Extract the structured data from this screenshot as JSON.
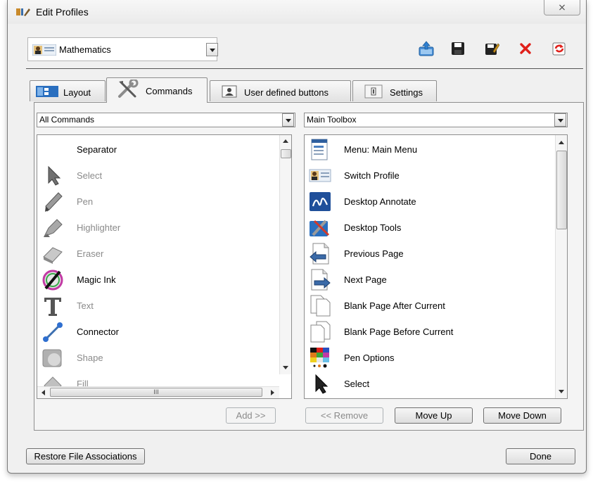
{
  "window": {
    "title": "Edit Profiles",
    "close_glyph": "⨯"
  },
  "profile": {
    "selected": "Mathematics"
  },
  "toolbar": {
    "icons": [
      "upload-profile-icon",
      "save-icon",
      "edit-save-icon",
      "delete-icon",
      "refresh-icon"
    ]
  },
  "tabs": [
    {
      "label": "Layout",
      "icon": "layout-icon"
    },
    {
      "label": "Commands",
      "icon": "tools-icon"
    },
    {
      "label": "User defined buttons",
      "icon": "user-card-icon"
    },
    {
      "label": "Settings",
      "icon": "settings-icon"
    }
  ],
  "left_combo": {
    "value": "All Commands"
  },
  "right_combo": {
    "value": "Main Toolbox"
  },
  "left_list": [
    {
      "label": "Separator",
      "icon": "",
      "enabled": true
    },
    {
      "label": "Select",
      "icon": "cursor-arrow-icon",
      "enabled": false
    },
    {
      "label": "Pen",
      "icon": "pen-icon",
      "enabled": false
    },
    {
      "label": "Highlighter",
      "icon": "highlighter-icon",
      "enabled": false
    },
    {
      "label": "Eraser",
      "icon": "eraser-icon",
      "enabled": false
    },
    {
      "label": "Magic Ink",
      "icon": "magic-ink-icon",
      "enabled": true
    },
    {
      "label": "Text",
      "icon": "text-icon",
      "enabled": false
    },
    {
      "label": "Connector",
      "icon": "connector-icon",
      "enabled": true
    },
    {
      "label": "Shape",
      "icon": "shape-icon",
      "enabled": false
    },
    {
      "label": "Fill",
      "icon": "fill-icon",
      "enabled": false
    }
  ],
  "right_list": [
    {
      "label": "Menu: Main Menu",
      "icon": "menu-icon"
    },
    {
      "label": "Switch Profile",
      "icon": "switch-profile-icon"
    },
    {
      "label": "Desktop Annotate",
      "icon": "desktop-annotate-icon"
    },
    {
      "label": "Desktop Tools",
      "icon": "desktop-tools-icon"
    },
    {
      "label": "Previous Page",
      "icon": "previous-page-icon"
    },
    {
      "label": "Next Page",
      "icon": "next-page-icon"
    },
    {
      "label": "Blank Page After Current",
      "icon": "blank-page-after-icon"
    },
    {
      "label": "Blank Page Before Current",
      "icon": "blank-page-before-icon"
    },
    {
      "label": "Pen Options",
      "icon": "pen-options-icon"
    },
    {
      "label": "Select",
      "icon": "cursor-arrow-icon"
    }
  ],
  "hscroll": {
    "grip": "III"
  },
  "actions": {
    "add": "Add >>",
    "remove": "<< Remove",
    "move_up": "Move Up",
    "move_down": "Move Down"
  },
  "footer": {
    "restore": "Restore File Associations",
    "done": "Done"
  }
}
